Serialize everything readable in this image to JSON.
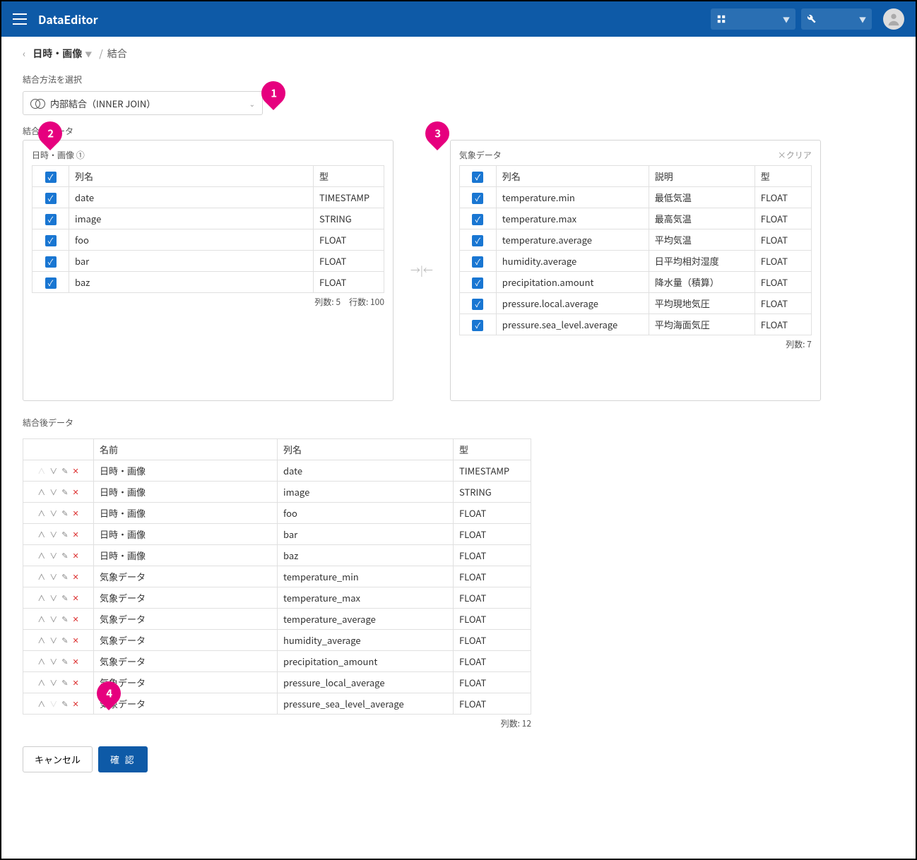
{
  "header": {
    "app_title": "DataEditor"
  },
  "breadcrumb": {
    "item1": "日時・画像",
    "item2": "結合"
  },
  "join_method": {
    "label": "結合方法を選択",
    "value": "内部結合（INNER JOIN）"
  },
  "source_label": "結合元データ",
  "left_panel": {
    "title": "日時・画像 ①",
    "headers": {
      "name": "列名",
      "type": "型"
    },
    "rows": [
      {
        "name": "date",
        "type": "TIMESTAMP"
      },
      {
        "name": "image",
        "type": "STRING"
      },
      {
        "name": "foo",
        "type": "FLOAT"
      },
      {
        "name": "bar",
        "type": "FLOAT"
      },
      {
        "name": "baz",
        "type": "FLOAT"
      }
    ],
    "meta": "列数: 5　行数: 100"
  },
  "right_panel": {
    "title": "気象データ",
    "clear": "×クリア",
    "headers": {
      "name": "列名",
      "desc": "説明",
      "type": "型"
    },
    "rows": [
      {
        "name": "temperature.min",
        "desc": "最低気温",
        "type": "FLOAT"
      },
      {
        "name": "temperature.max",
        "desc": "最高気温",
        "type": "FLOAT"
      },
      {
        "name": "temperature.average",
        "desc": "平均気温",
        "type": "FLOAT"
      },
      {
        "name": "humidity.average",
        "desc": "日平均相対湿度",
        "type": "FLOAT"
      },
      {
        "name": "precipitation.amount",
        "desc": "降水量（積算）",
        "type": "FLOAT"
      },
      {
        "name": "pressure.local.average",
        "desc": "平均現地気圧",
        "type": "FLOAT"
      },
      {
        "name": "pressure.sea_level.average",
        "desc": "平均海面気圧",
        "type": "FLOAT"
      }
    ],
    "meta": "列数: 7"
  },
  "result": {
    "label": "結合後データ",
    "headers": {
      "name": "名前",
      "col": "列名",
      "type": "型"
    },
    "rows": [
      {
        "name": "日時・画像",
        "col": "date",
        "type": "TIMESTAMP",
        "first": true
      },
      {
        "name": "日時・画像",
        "col": "image",
        "type": "STRING"
      },
      {
        "name": "日時・画像",
        "col": "foo",
        "type": "FLOAT"
      },
      {
        "name": "日時・画像",
        "col": "bar",
        "type": "FLOAT"
      },
      {
        "name": "日時・画像",
        "col": "baz",
        "type": "FLOAT"
      },
      {
        "name": "気象データ",
        "col": "temperature_min",
        "type": "FLOAT"
      },
      {
        "name": "気象データ",
        "col": "temperature_max",
        "type": "FLOAT"
      },
      {
        "name": "気象データ",
        "col": "temperature_average",
        "type": "FLOAT"
      },
      {
        "name": "気象データ",
        "col": "humidity_average",
        "type": "FLOAT"
      },
      {
        "name": "気象データ",
        "col": "precipitation_amount",
        "type": "FLOAT"
      },
      {
        "name": "気象データ",
        "col": "pressure_local_average",
        "type": "FLOAT"
      },
      {
        "name": "気象データ",
        "col": "pressure_sea_level_average",
        "type": "FLOAT",
        "last": true
      }
    ],
    "meta": "列数: 12"
  },
  "buttons": {
    "cancel": "キャンセル",
    "confirm": "確 認"
  },
  "pins": {
    "p1": "1",
    "p2": "2",
    "p3": "3",
    "p4": "4"
  }
}
